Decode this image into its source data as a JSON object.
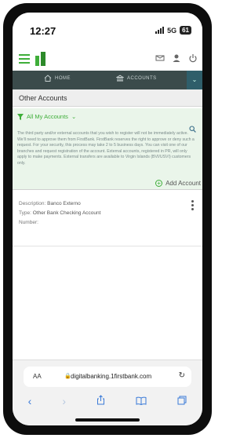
{
  "status": {
    "time": "12:27",
    "network": "5G",
    "battery": "61"
  },
  "nav": {
    "home": "HOME",
    "accounts": "ACCOUNTS"
  },
  "page": {
    "title": "Other Accounts"
  },
  "filter": {
    "label": "All My Accounts",
    "disclaimer": "The third party and/or external accounts that you wish to register will not be immediately active. We'll need to approve them from FirstBank. FirstBank reserves the right to approve or deny such a request. For your security, this process may take 2 to 5 business days. You can visit one of our branches and request registration of the account. External accounts, registered in PR, will only apply to make payments. External transfers are available to Virgin Islands (BVI/USVI) customers only.",
    "add_label": "Add Account"
  },
  "account": {
    "description_label": "Description:",
    "description": "Banco Externo",
    "type_label": "Type:",
    "type": "Other Bank Checking Account",
    "number_label": "Number:",
    "number": ""
  },
  "browser": {
    "aa": "AA",
    "url": "digitalbanking.1firstbank.com"
  },
  "colors": {
    "brand_green": "#3fae3a",
    "nav_bg": "#3b4b4b",
    "ios_blue": "#3b7bd8"
  }
}
